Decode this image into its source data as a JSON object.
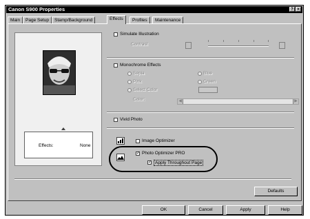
{
  "window": {
    "title": "Canon S900 Properties",
    "help_button": "?",
    "close_button": "×"
  },
  "tabs": [
    "Main",
    "Page Setup",
    "Stamp/Background",
    "Effects",
    "Profiles",
    "Maintenance"
  ],
  "active_tab": "Effects",
  "preview": {
    "effects_label": "Effects:",
    "effects_value": "None"
  },
  "simulate_illustration": {
    "label": "Simulate Illustration",
    "checked": false,
    "contrast_label": "Contrast"
  },
  "monochrome": {
    "label": "Monochrome Effects",
    "checked": false,
    "options": [
      "Sepia",
      "Blue",
      "Pink",
      "Green",
      "Select Color"
    ],
    "color_label": "Color:"
  },
  "vivid_photo": {
    "label": "Vivid Photo",
    "checked": false
  },
  "image_optimizer": {
    "label": "Image Optimizer",
    "checked": false
  },
  "photo_optimizer": {
    "label": "Photo Optimizer PRO",
    "checked": true,
    "apply_label": "Apply Throughout Page",
    "apply_checked": true,
    "check_mark": "✓"
  },
  "buttons": {
    "defaults": "Defaults",
    "ok": "OK",
    "cancel": "Cancel",
    "apply": "Apply",
    "help": "Help"
  }
}
